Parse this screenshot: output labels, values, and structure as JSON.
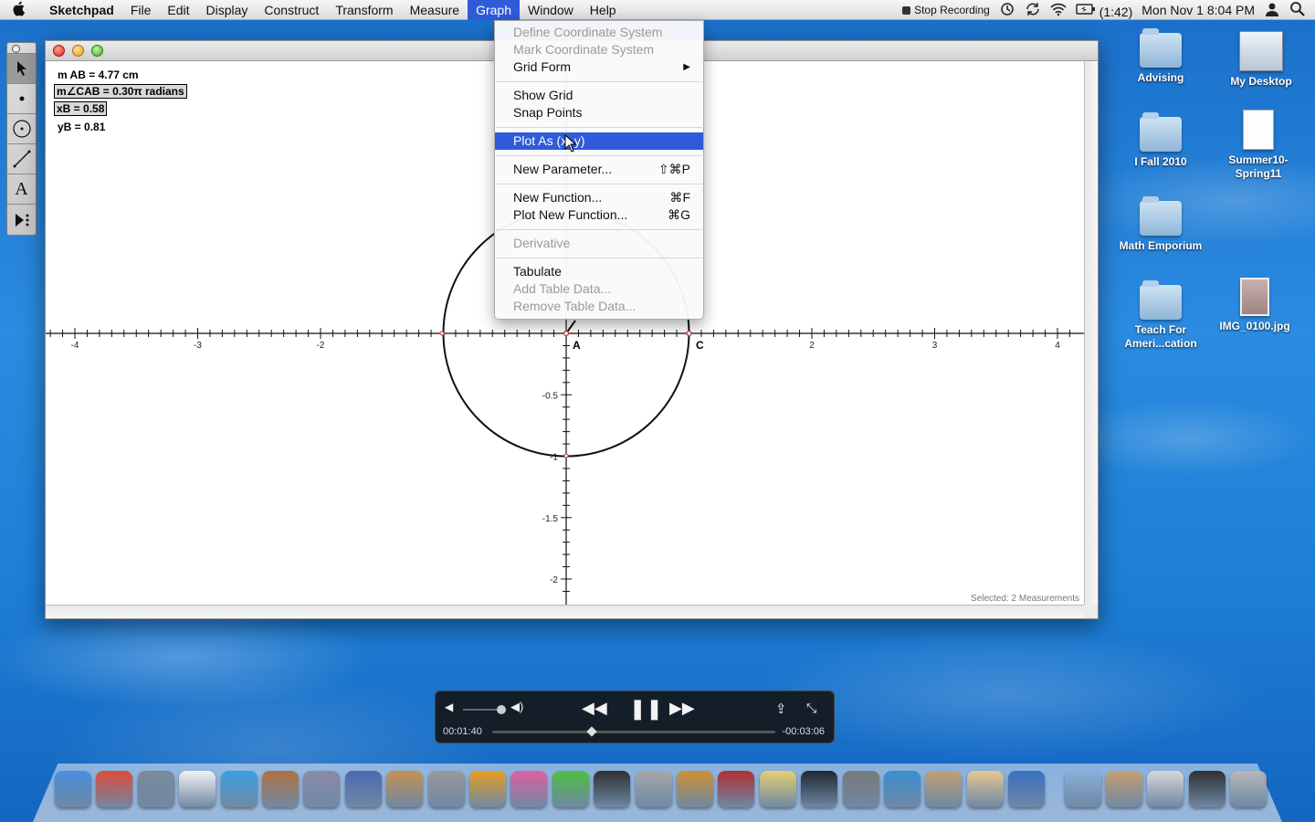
{
  "menubar": {
    "app_name": "Sketchpad",
    "menus": [
      "File",
      "Edit",
      "Display",
      "Construct",
      "Transform",
      "Measure",
      "Graph",
      "Window",
      "Help"
    ],
    "active_menu": "Graph",
    "status": {
      "recording": "Stop Recording",
      "battery": "(1:42)",
      "datetime": "Mon Nov 1  8:04 PM"
    }
  },
  "graph_menu": {
    "items": [
      {
        "label": "Define Coordinate System",
        "enabled": false
      },
      {
        "label": "Mark Coordinate System",
        "enabled": false
      },
      {
        "label": "Grid Form",
        "enabled": true,
        "submenu": true
      },
      {
        "label": "Show Grid",
        "enabled": true
      },
      {
        "label": "Snap Points",
        "enabled": true
      },
      {
        "label": "Plot As (x, y)",
        "enabled": true,
        "highlighted": true
      },
      {
        "label": "New Parameter...",
        "enabled": true,
        "shortcut": "⇧⌘P"
      },
      {
        "label": "New Function...",
        "enabled": true,
        "shortcut": "⌘F"
      },
      {
        "label": "Plot New Function...",
        "enabled": true,
        "shortcut": "⌘G"
      },
      {
        "label": "Derivative",
        "enabled": false
      },
      {
        "label": "Tabulate",
        "enabled": true
      },
      {
        "label": "Add Table Data...",
        "enabled": false
      },
      {
        "label": "Remove Table Data...",
        "enabled": false
      }
    ]
  },
  "sketch": {
    "measurements": [
      {
        "text": "m AB = 4.77 cm",
        "selected": false
      },
      {
        "text": "m∠CAB = 0.30π radians",
        "selected": true
      },
      {
        "text": "xB = 0.58",
        "selected": true
      },
      {
        "text": "yB = 0.81",
        "selected": false
      }
    ],
    "point_labels": {
      "A": "A",
      "C": "C"
    },
    "x_tick_labels": [
      "-4",
      "-3",
      "-2",
      "2",
      "3",
      "4"
    ],
    "y_tick_labels": [
      "-0.5",
      "-1",
      "-1.5",
      "-2"
    ],
    "status_text": "Selected: 2 Measurements"
  },
  "desktop_icons": [
    {
      "label": "Advising",
      "kind": "folder"
    },
    {
      "label": "My Desktop",
      "kind": "desktop"
    },
    {
      "label": "I Fall 2010",
      "kind": "folder"
    },
    {
      "label": "Summer10-Spring11",
      "kind": "document"
    },
    {
      "label": "Math Emporium",
      "kind": "folder"
    },
    {
      "label": "Teach For Ameri...cation",
      "kind": "folder"
    },
    {
      "label": "IMG_0100.jpg",
      "kind": "image"
    }
  ],
  "player": {
    "elapsed": "00:01:40",
    "remaining": "-00:03:06",
    "progress": 0.35
  },
  "dock": {
    "apps": [
      "finder-icon",
      "chrome-icon",
      "mail-icon",
      "ical-icon",
      "itunes-icon",
      "iphoto-icon",
      "pencil-icon",
      "keynote-icon",
      "presentation-icon",
      "calculator-icon",
      "colorsync-icon",
      "pinwheel-icon",
      "grapher-icon",
      "inkscape-icon",
      "latex-icon",
      "webworks-icon",
      "dictionary-icon",
      "stickies-icon",
      "activity-monitor-icon",
      "system-preferences-icon",
      "safari-icon",
      "preview-icon",
      "addressbook-icon",
      "quicktime-icon",
      "applications-folder-icon",
      "home-folder-icon",
      "pdf-icon",
      "gradebook-icon",
      "trash-icon"
    ]
  }
}
